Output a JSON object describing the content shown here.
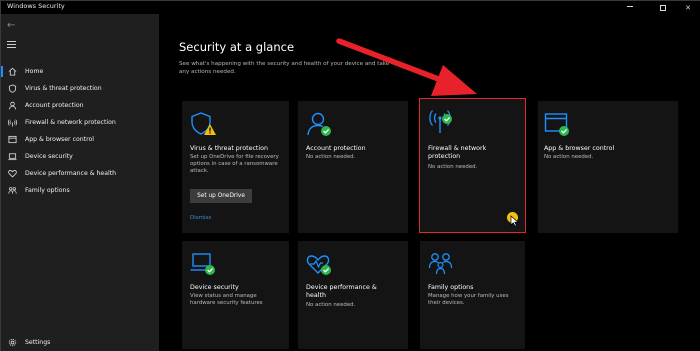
{
  "window": {
    "title": "Windows Security",
    "controls": [
      "minimize",
      "maximize",
      "close"
    ]
  },
  "sidebar": {
    "items": [
      {
        "label": "Home",
        "icon": "home-icon",
        "selected": true
      },
      {
        "label": "Virus & threat protection",
        "icon": "shield-icon"
      },
      {
        "label": "Account protection",
        "icon": "person-icon"
      },
      {
        "label": "Firewall & network protection",
        "icon": "wifi-signal-icon"
      },
      {
        "label": "App & browser control",
        "icon": "app-window-icon"
      },
      {
        "label": "Device security",
        "icon": "laptop-icon"
      },
      {
        "label": "Device performance & health",
        "icon": "heart-icon"
      },
      {
        "label": "Family options",
        "icon": "family-icon"
      }
    ],
    "settings_label": "Settings"
  },
  "main": {
    "title": "Security at a glance",
    "subtitle": "See what's happening with the security and health of your device and take any actions needed.",
    "tiles": [
      {
        "title": "Virus & threat protection",
        "desc": "Set up OneDrive for file recovery options in case of a ransomware attack.",
        "button": "Set up OneDrive",
        "link": "Dismiss",
        "status": "warning"
      },
      {
        "title": "Account protection",
        "desc": "No action needed.",
        "status": "ok"
      },
      {
        "title": "Firewall & network protection",
        "desc": "No action needed.",
        "status": "ok"
      },
      {
        "title": "App & browser control",
        "desc": "No action needed.",
        "status": "ok"
      },
      {
        "title": "Device security",
        "desc": "View status and manage hardware security features",
        "status": "ok"
      },
      {
        "title": "Device performance & health",
        "desc": "No action needed.",
        "status": "ok"
      },
      {
        "title": "Family options",
        "desc": "Manage how your family uses their devices.",
        "status": "none"
      }
    ]
  },
  "colors": {
    "accent": "#1e90ff",
    "ok": "#2db84d",
    "warning": "#f7c000",
    "annotation": "#e0282b"
  }
}
